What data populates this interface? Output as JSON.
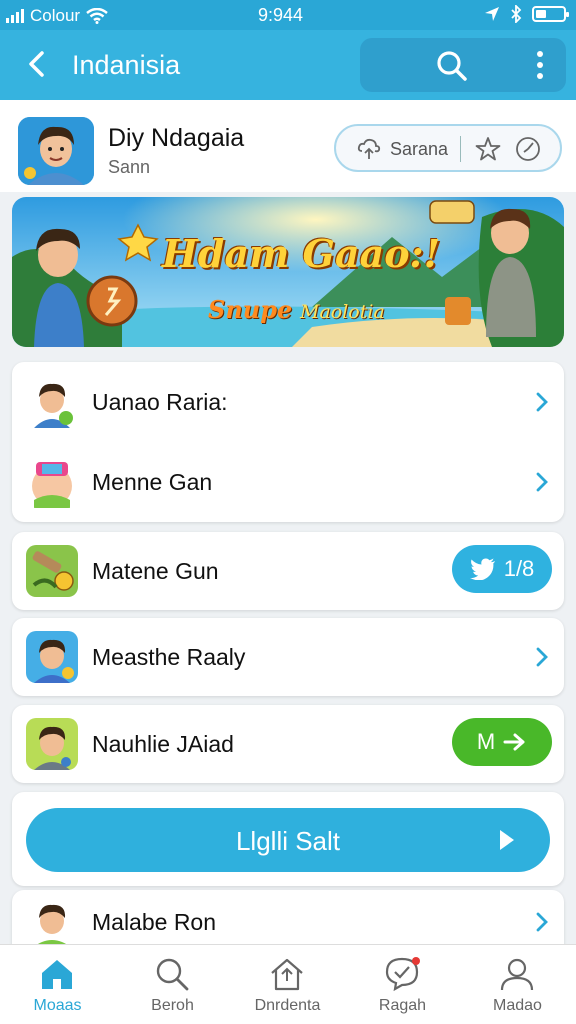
{
  "status_bar": {
    "carrier": "Colour",
    "time": "9:944"
  },
  "app_bar": {
    "title": "Indanisia"
  },
  "app_header": {
    "name": "Diy Ndagaia",
    "subtitle": "Sann",
    "action_pill_label": "Sarana"
  },
  "banner": {
    "title": "Hdam Gaao:!",
    "subtitle_1": "Snupe",
    "subtitle_2": "Maolotia"
  },
  "list": [
    {
      "label": "Uanao Raria:"
    },
    {
      "label": "Menne Gan"
    },
    {
      "label": "Matene Gun",
      "badge": "1/8",
      "badge_color": "#2fb2e0"
    },
    {
      "label": "Measthe Raaly"
    },
    {
      "label": "Nauhlie JAiad",
      "badge": "M",
      "badge_color": "#49b829"
    },
    {
      "label": "Malabe Ron"
    }
  ],
  "cta": {
    "label": "Llglli Salt"
  },
  "tabs": [
    {
      "label": "Moaas",
      "icon": "home-icon",
      "active": true
    },
    {
      "label": "Beroh",
      "icon": "search-icon"
    },
    {
      "label": "Dnrdenta",
      "icon": "house-outline-icon"
    },
    {
      "label": "Ragah",
      "icon": "chat-check-icon"
    },
    {
      "label": "Madao",
      "icon": "profile-icon"
    }
  ],
  "colors": {
    "primary": "#36b3df",
    "accent_green": "#49b829",
    "background": "#eef1f4"
  }
}
